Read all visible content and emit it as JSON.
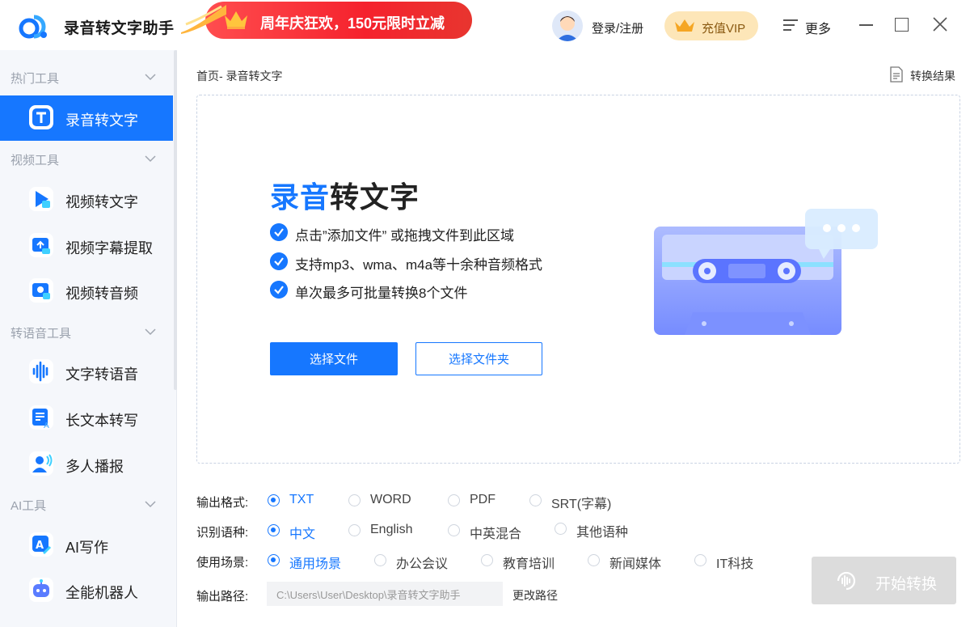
{
  "app": {
    "title": "录音转文字助手"
  },
  "promo": {
    "text": "周年庆狂欢，150元限时立减"
  },
  "header": {
    "login": "登录/注册",
    "vip": "充值VIP",
    "more": "更多"
  },
  "sidebar": {
    "groups": [
      {
        "title": "热门工具",
        "items": [
          {
            "label": "录音转文字",
            "icon": "text-t-icon",
            "active": true
          }
        ]
      },
      {
        "title": "视频工具",
        "items": [
          {
            "label": "视频转文字",
            "icon": "video-text-icon"
          },
          {
            "label": "视频字幕提取",
            "icon": "subtitle-extract-icon"
          },
          {
            "label": "视频转音频",
            "icon": "video-audio-icon"
          }
        ]
      },
      {
        "title": "转语音工具",
        "items": [
          {
            "label": "文字转语音",
            "icon": "waveform-icon"
          },
          {
            "label": "长文本转写",
            "icon": "long-text-icon"
          },
          {
            "label": "多人播报",
            "icon": "multi-speaker-icon"
          }
        ]
      },
      {
        "title": "AI工具",
        "items": [
          {
            "label": "AI写作",
            "icon": "ai-write-icon"
          },
          {
            "label": "全能机器人",
            "icon": "robot-icon"
          }
        ]
      }
    ]
  },
  "main": {
    "breadcrumb": "首页- 录音转文字",
    "result_link": "转换结果",
    "hero": {
      "title_highlight": "录音",
      "title_rest": "转文字",
      "features": [
        "点击”添加文件” 或拖拽文件到此区域",
        "支持mp3、wma、m4a等十余种音频格式",
        "单次最多可批量转换8个文件"
      ],
      "select_file": "选择文件",
      "select_folder": "选择文件夹"
    },
    "options": {
      "format": {
        "label": "输出格式:",
        "choices": [
          "TXT",
          "WORD",
          "PDF",
          "SRT(字幕)"
        ],
        "selected": "TXT"
      },
      "language": {
        "label": "识别语种:",
        "choices": [
          "中文",
          "English",
          "中英混合",
          "其他语种"
        ],
        "selected": "中文"
      },
      "scene": {
        "label": "使用场景:",
        "choices": [
          "通用场景",
          "办公会议",
          "教育培训",
          "新闻媒体",
          "IT科技"
        ],
        "selected": "通用场景"
      },
      "path": {
        "label": "输出路径:",
        "value": "C:\\Users\\User\\Desktop\\录音转文字助手",
        "change": "更改路径"
      }
    },
    "start_button": "开始转换"
  },
  "colors": {
    "accent": "#1677ff",
    "promo": "#f5222d",
    "vip_bg": "#fde6b8",
    "disabled": "#dcdcdc"
  }
}
